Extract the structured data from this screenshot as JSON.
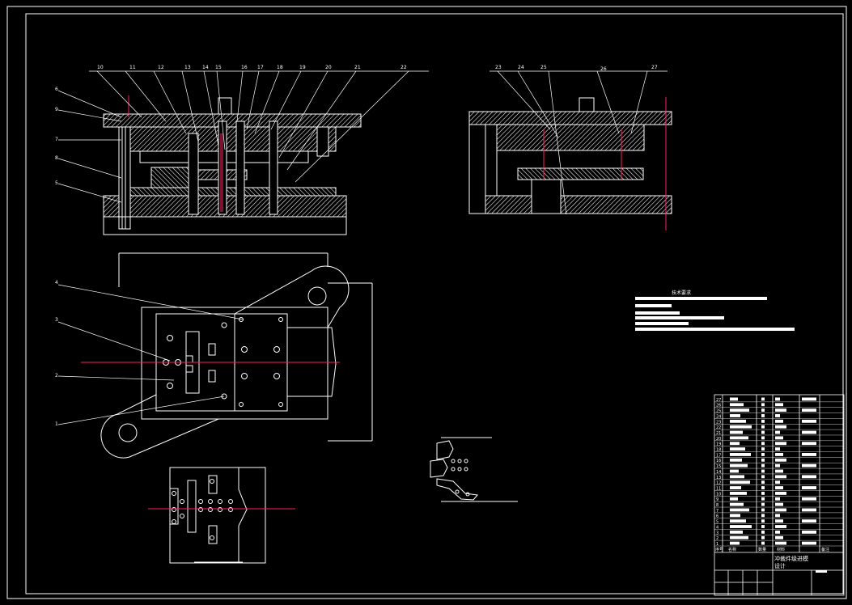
{
  "drawing": {
    "background": "#000000",
    "line_color": "#ffffff",
    "centerline_color": "#ff2060",
    "section_view_main": {
      "labels_left": [
        "6",
        "9",
        "7",
        "8",
        "5"
      ],
      "labels_top": [
        "10",
        "11",
        "12",
        "13",
        "14",
        "15",
        "16",
        "17",
        "18",
        "19",
        "20",
        "21",
        "22"
      ]
    },
    "section_view_side": {
      "labels_top": [
        "23",
        "24",
        "25",
        "26",
        "27"
      ]
    },
    "plan_view": {
      "labels_left": [
        "4",
        "3",
        "2",
        "1"
      ]
    },
    "tech_requirements": {
      "title": "技术要求"
    },
    "title_block": {
      "title": "冲裁件级进模",
      "subtitle": "设计",
      "header_cells": [
        "序号",
        "名称",
        "数量",
        "材料",
        "备注"
      ],
      "row_numbers": [
        "27",
        "26",
        "25",
        "24",
        "23",
        "22",
        "21",
        "20",
        "19",
        "18",
        "17",
        "16",
        "15",
        "14",
        "13",
        "12",
        "11",
        "10",
        "9",
        "8",
        "7",
        "6",
        "5",
        "4",
        "3",
        "2",
        "1"
      ]
    }
  }
}
